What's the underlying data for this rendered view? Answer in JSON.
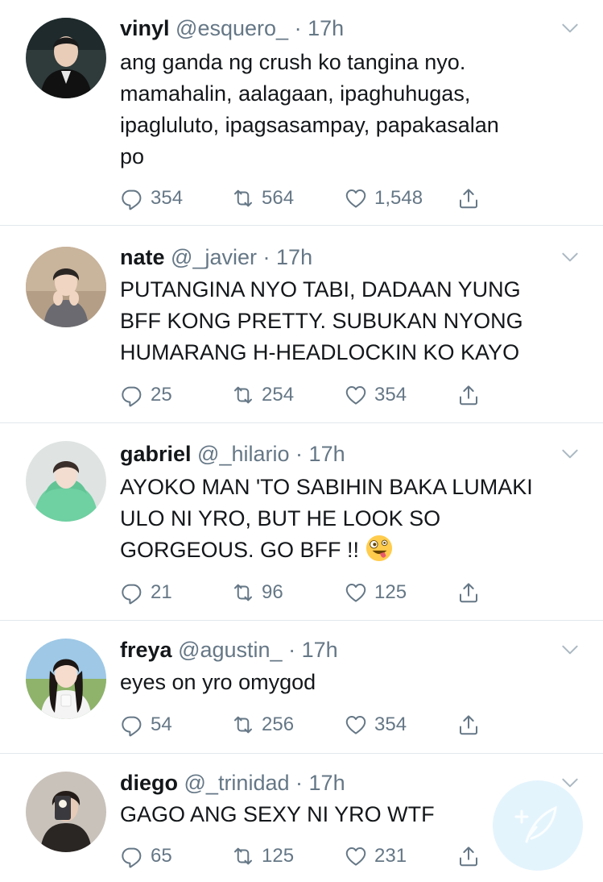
{
  "tweets": [
    {
      "name": "vinyl",
      "handle": "@esquero_",
      "separator": "·",
      "time": "17h",
      "lines": [
        "ang ganda ng crush ko tangina nyo.",
        "mamahalin, aalagaan, ipaghuhugas,",
        "ipagluluto, ipagsasampay, papakasalan",
        "po"
      ],
      "replies": "354",
      "retweets": "564",
      "likes": "1,548"
    },
    {
      "name": "nate",
      "handle": "@_javier",
      "separator": "·",
      "time": "17h",
      "lines": [
        "PUTANGINA NYO TABI, DADAAN YUNG",
        "BFF KONG PRETTY. SUBUKAN NYONG",
        "HUMARANG H-HEADLOCKIN KO KAYO"
      ],
      "replies": "25",
      "retweets": "254",
      "likes": "354"
    },
    {
      "name": "gabriel",
      "handle": "@_hilario",
      "separator": "·",
      "time": "17h",
      "lines": [
        "AYOKO MAN 'TO SABIHIN BAKA LUMAKI",
        "ULO NI YRO, BUT HE LOOK SO",
        "GORGEOUS. GO BFF !!"
      ],
      "emoji": "zany-face-emoji",
      "replies": "21",
      "retweets": "96",
      "likes": "125"
    },
    {
      "name": "freya",
      "handle": "@agustin_",
      "separator": "·",
      "time": "17h",
      "lines": [
        "eyes on yro omygod"
      ],
      "replies": "54",
      "retweets": "256",
      "likes": "354"
    },
    {
      "name": "diego",
      "handle": "@_trinidad",
      "separator": "·",
      "time": "17h",
      "lines": [
        "GAGO ANG SEXY NI YRO WTF"
      ],
      "replies": "65",
      "retweets": "125",
      "likes": "231"
    }
  ],
  "icons": {
    "reply": "reply-icon",
    "retweet": "retweet-icon",
    "like": "heart-icon",
    "share": "share-icon",
    "menu": "chevron-down-icon",
    "compose": "compose-feather-icon"
  },
  "colors": {
    "text": "#14171a",
    "secondary": "#657786",
    "divider": "#e1e8ed",
    "accent": "#1da1f2"
  }
}
